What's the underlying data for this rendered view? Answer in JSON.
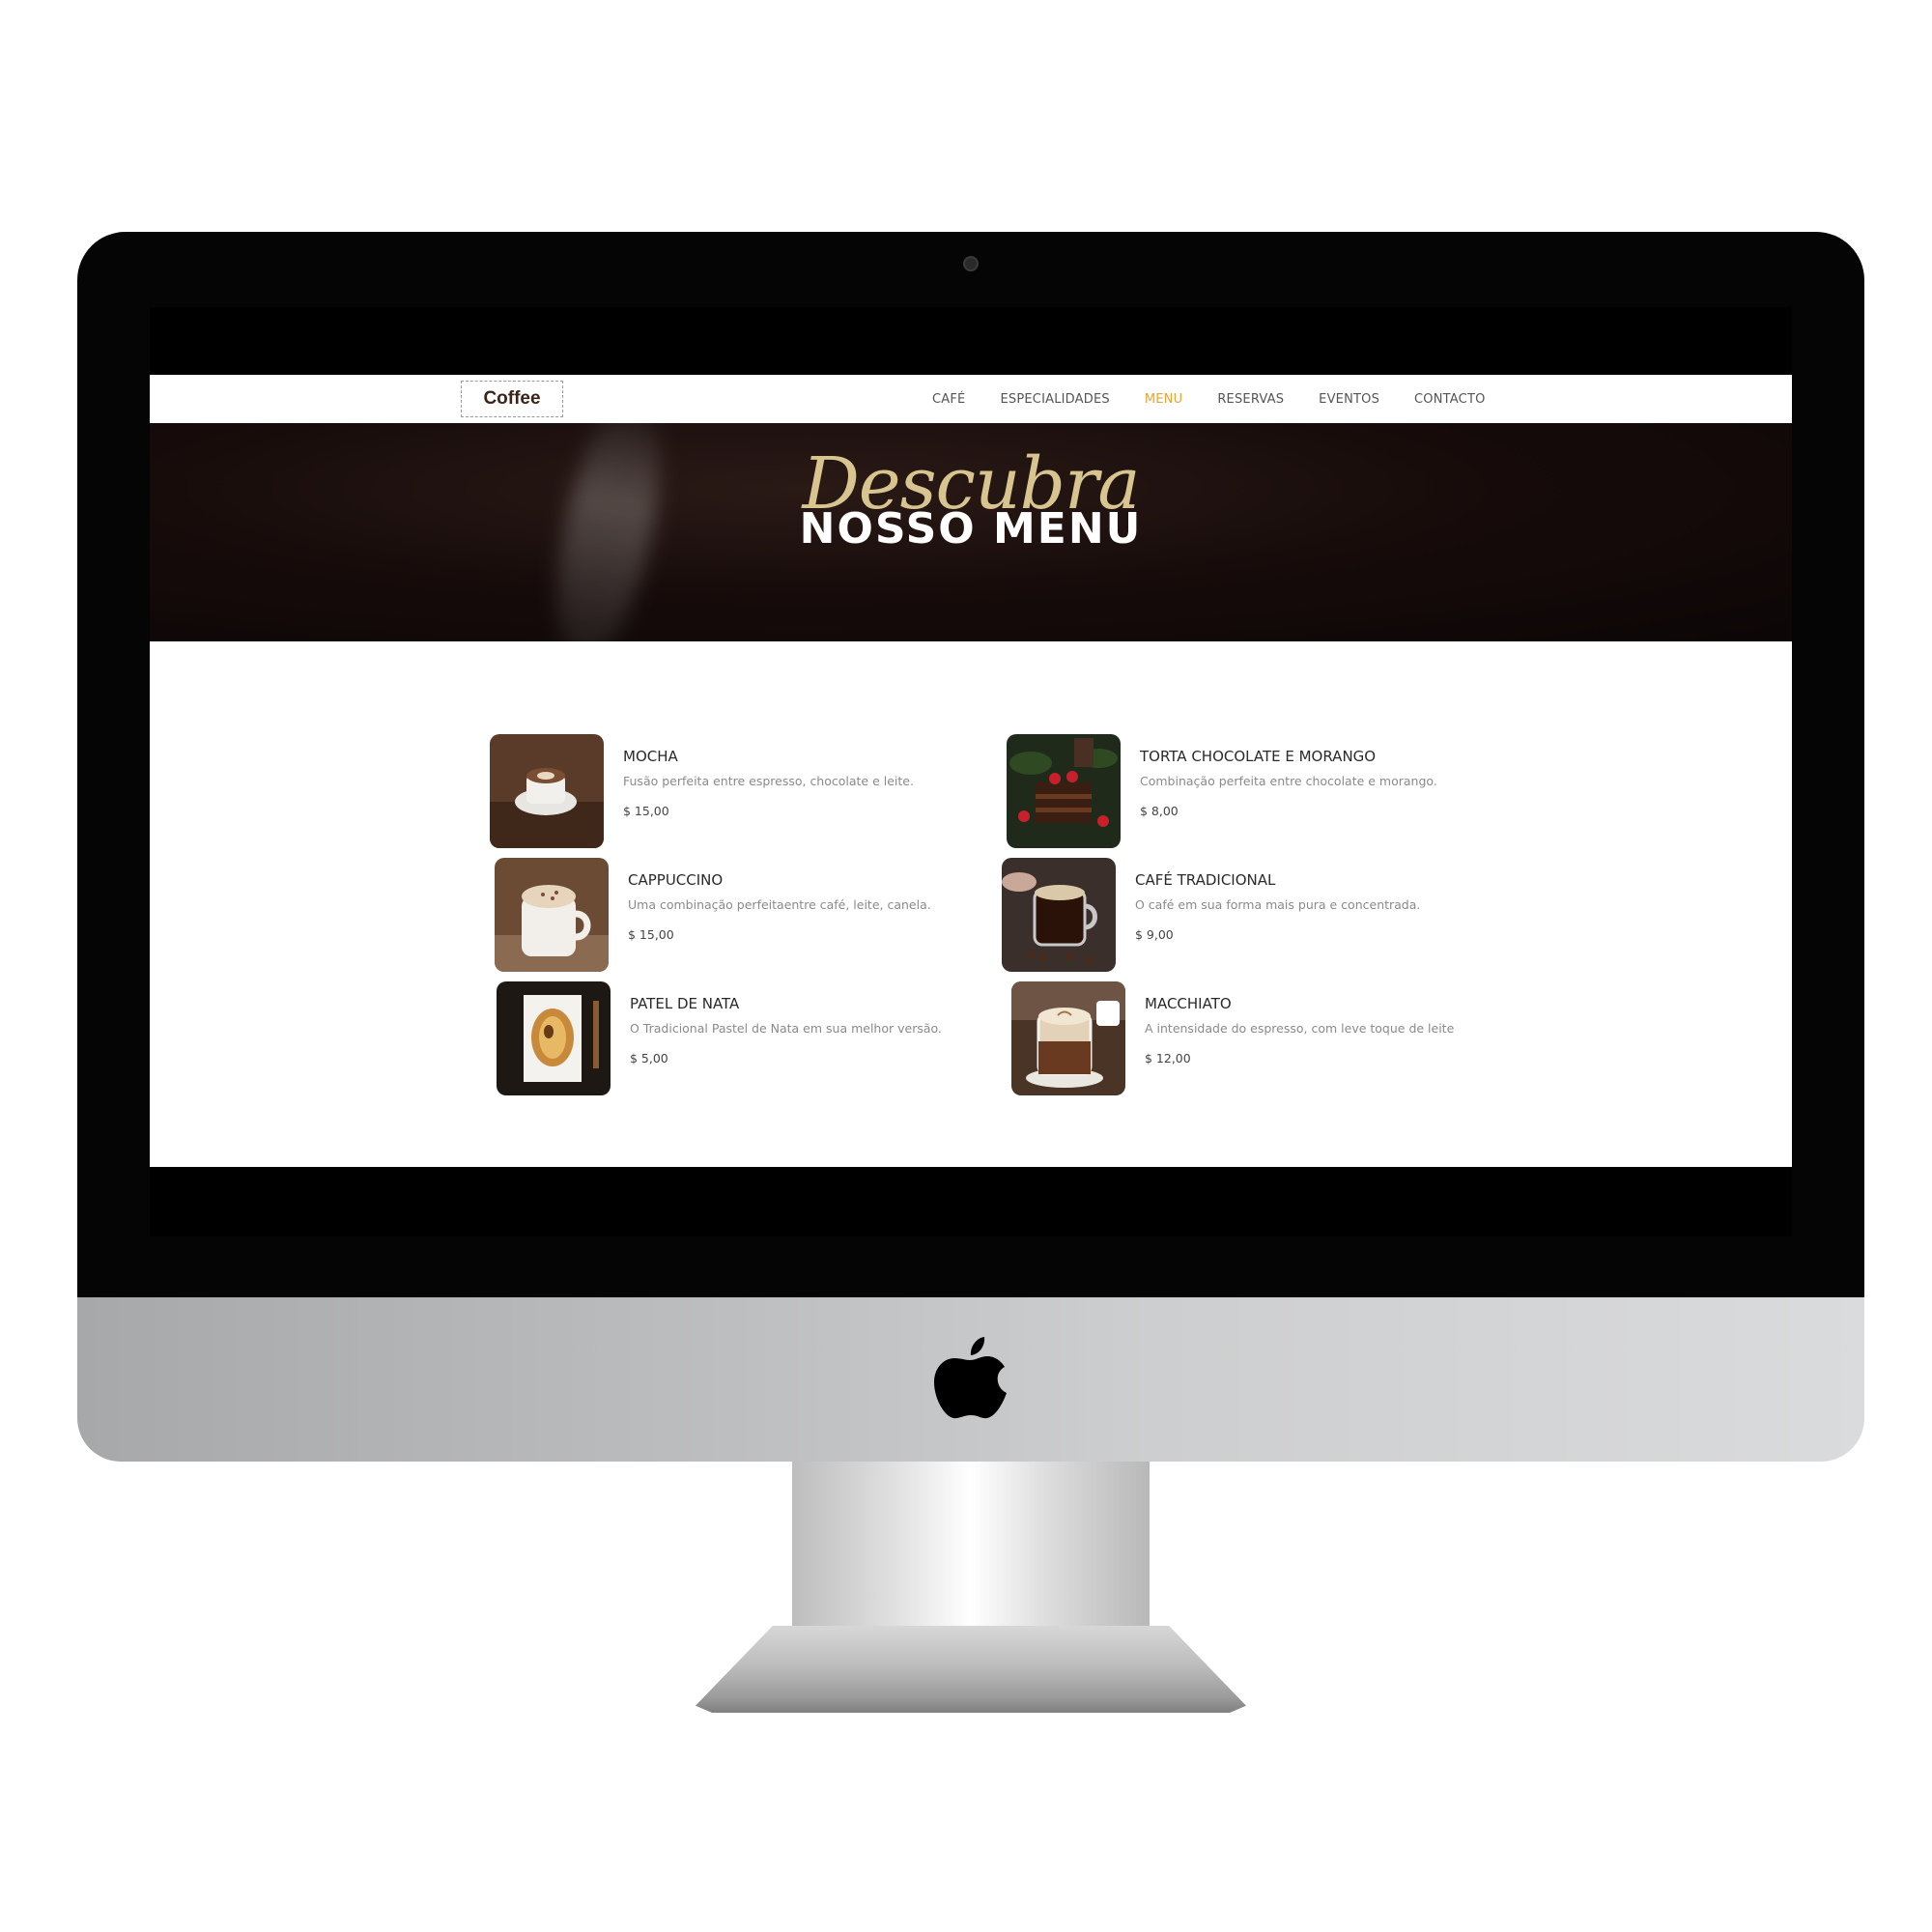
{
  "site": {
    "logo_text": "Coffee",
    "nav": {
      "items": [
        {
          "label": "CAFÉ",
          "active": false
        },
        {
          "label": "ESPECIALIDADES",
          "active": false
        },
        {
          "label": "MENU",
          "active": true
        },
        {
          "label": "RESERVAS",
          "active": false
        },
        {
          "label": "EVENTOS",
          "active": false
        },
        {
          "label": "CONTACTO",
          "active": false
        }
      ],
      "active_color": "#e8a23a"
    },
    "hero": {
      "script_text": "Descubra",
      "title": "NOSSO MENU"
    },
    "menu": {
      "items": [
        {
          "name": "MOCHA",
          "description": "Fusão perfeita entre espresso, chocolate e leite.",
          "price": "$ 15,00",
          "icon": "mocha-photo"
        },
        {
          "name": "TORTA CHOCOLATE E MORANGO",
          "description": "Combinação perfeita entre chocolate e morango.",
          "price": "$ 8,00",
          "icon": "chocolate-cake-photo"
        },
        {
          "name": "CAPPUCCINO",
          "description": "Uma combinação perfeitaentre café, leite, canela.",
          "price": "$ 15,00",
          "icon": "cappuccino-photo"
        },
        {
          "name": "CAFÉ TRADICIONAL",
          "description": "O café em sua forma mais pura e concentrada.",
          "price": "$ 9,00",
          "icon": "coffee-cup-photo"
        },
        {
          "name": "PATEL DE NATA",
          "description": "O Tradicional Pastel de Nata em sua melhor versão.",
          "price": "$ 5,00",
          "icon": "pastel-de-nata-photo"
        },
        {
          "name": "MACCHIATO",
          "description": "A intensidade do espresso, com leve toque de leite",
          "price": "$ 12,00",
          "icon": "macchiato-photo"
        }
      ]
    }
  },
  "colors": {
    "hero_background": "#160b0a",
    "script_gold": "#d8c48f",
    "bezel": "#050505"
  }
}
